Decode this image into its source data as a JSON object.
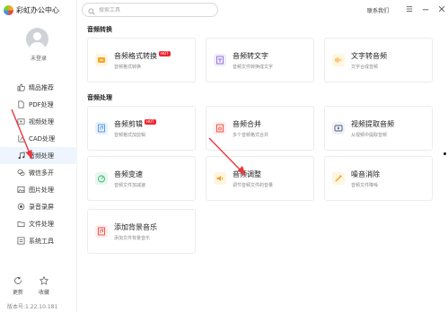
{
  "app": {
    "name": "彩虹办公中心"
  },
  "user": {
    "login_text": "未登录"
  },
  "search": {
    "placeholder": "搜索工具"
  },
  "window": {
    "contact": "联系我们"
  },
  "sidebar": {
    "items": [
      {
        "label": "精品推荐",
        "icon": "thumb-up-icon"
      },
      {
        "label": "PDF处理",
        "icon": "pdf-file-icon"
      },
      {
        "label": "视频处理",
        "icon": "video-icon"
      },
      {
        "label": "CAD处理",
        "icon": "cad-icon"
      },
      {
        "label": "音频处理",
        "icon": "music-note-icon",
        "active": true
      },
      {
        "label": "微信多开",
        "icon": "wechat-icon"
      },
      {
        "label": "图片处理",
        "icon": "image-icon"
      },
      {
        "label": "录音录屏",
        "icon": "record-icon"
      },
      {
        "label": "文件处理",
        "icon": "folder-icon"
      },
      {
        "label": "系统工具",
        "icon": "system-tools-icon"
      }
    ],
    "bottom": {
      "update": "更新",
      "favorite": "收藏"
    },
    "version": "版本号:1.22.10.181"
  },
  "sections": [
    {
      "title": "音频转换",
      "cards": [
        {
          "title": "音频格式转换",
          "sub": "音频格式转换",
          "hot": "HOT",
          "icon": "audio-convert-icon"
        },
        {
          "title": "音频转文字",
          "sub": "音频文件转换成文字",
          "icon": "audio-to-text-icon"
        },
        {
          "title": "文字转音频",
          "sub": "文字合成音频",
          "icon": "text-to-audio-icon"
        }
      ]
    },
    {
      "title": "音频处理",
      "cards": [
        {
          "title": "音频剪辑",
          "sub": "音频格式加剪辑",
          "hot": "HOT",
          "icon": "audio-cut-icon"
        },
        {
          "title": "音频合并",
          "sub": "多个音频格式合并",
          "icon": "audio-merge-icon"
        },
        {
          "title": "视频提取音频",
          "sub": "从视频中提取音频",
          "icon": "video-extract-audio-icon"
        },
        {
          "title": "音频变速",
          "sub": "音频文件加减速",
          "icon": "audio-speed-icon"
        },
        {
          "title": "音频调整",
          "sub": "调节音频文件的音量",
          "icon": "volume-icon"
        },
        {
          "title": "噪音消除",
          "sub": "音频文件降噪",
          "icon": "noise-remove-icon"
        },
        {
          "title": "添加背景音乐",
          "sub": "添加文件背景音乐",
          "icon": "bg-music-icon"
        }
      ]
    }
  ],
  "colors": {
    "accent": "#1677ff",
    "hot": "#f5222d",
    "arrow": "#e8383d"
  }
}
